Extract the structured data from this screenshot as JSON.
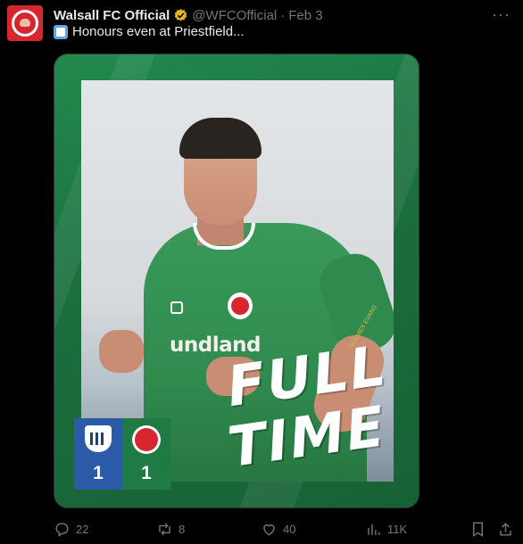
{
  "tweet": {
    "author_name": "Walsall FC Official",
    "handle": "@WFCOfficial",
    "separator": "·",
    "date": "Feb 3",
    "more": "···",
    "text": "Honours even at Priestfield..."
  },
  "media": {
    "sponsor_text": "undland",
    "sleeve_text": "HOLMES EVANS",
    "full_time_line1": "FULL",
    "full_time_line2": "TIME",
    "home_score": "1",
    "away_score": "1"
  },
  "actions": {
    "replies": "22",
    "reposts": "8",
    "likes": "40",
    "views": "11K"
  },
  "colors": {
    "background": "#000000",
    "brand_green": "#1f7a44",
    "walsall_red": "#d8262e",
    "gillingham_blue": "#2b5aa8",
    "verified_gold": "#e2b719"
  }
}
